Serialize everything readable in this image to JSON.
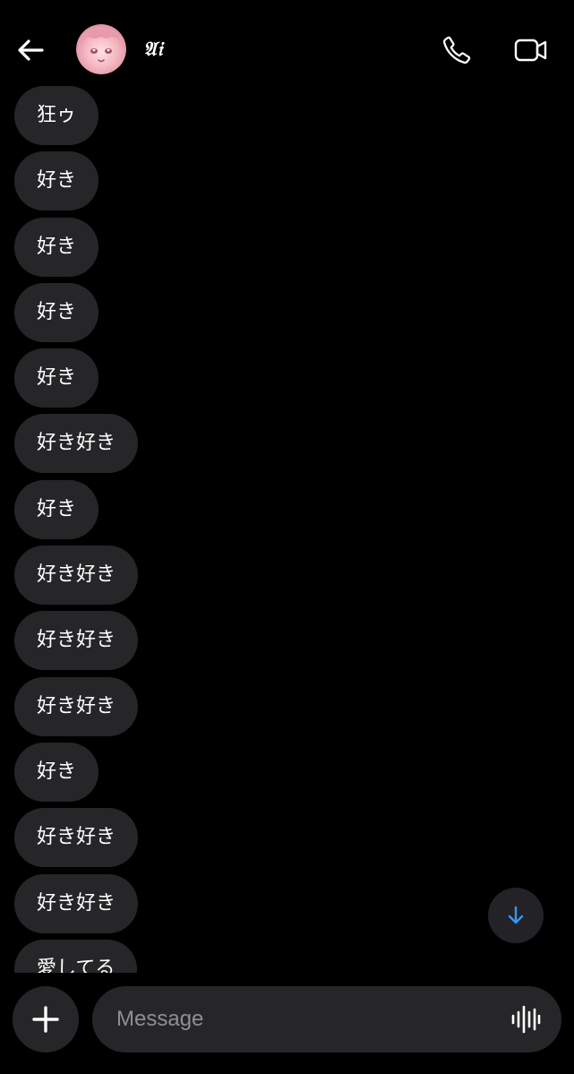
{
  "header": {
    "contact_name": "𝔄𝔦",
    "icons": {
      "back": "back-arrow-icon",
      "call": "phone-icon",
      "video": "video-camera-icon"
    }
  },
  "messages": [
    {
      "text": "狂ゥ"
    },
    {
      "text": "好き"
    },
    {
      "text": "好き"
    },
    {
      "text": "好き"
    },
    {
      "text": "好き"
    },
    {
      "text": "好き好き"
    },
    {
      "text": "好き"
    },
    {
      "text": "好き好き"
    },
    {
      "text": "好き好き"
    },
    {
      "text": "好き好き"
    },
    {
      "text": "好き"
    },
    {
      "text": "好き好き"
    },
    {
      "text": "好き好き"
    },
    {
      "text": "愛してる"
    }
  ],
  "composer": {
    "placeholder": "Message",
    "icons": {
      "add": "plus-icon",
      "voice": "audio-waveform-icon"
    }
  },
  "scroll_button": {
    "icon": "arrow-down-icon",
    "color": "#3897f0"
  },
  "colors": {
    "background": "#000000",
    "bubble": "#262629",
    "accent": "#3897f0",
    "placeholder": "#8e8e93"
  }
}
